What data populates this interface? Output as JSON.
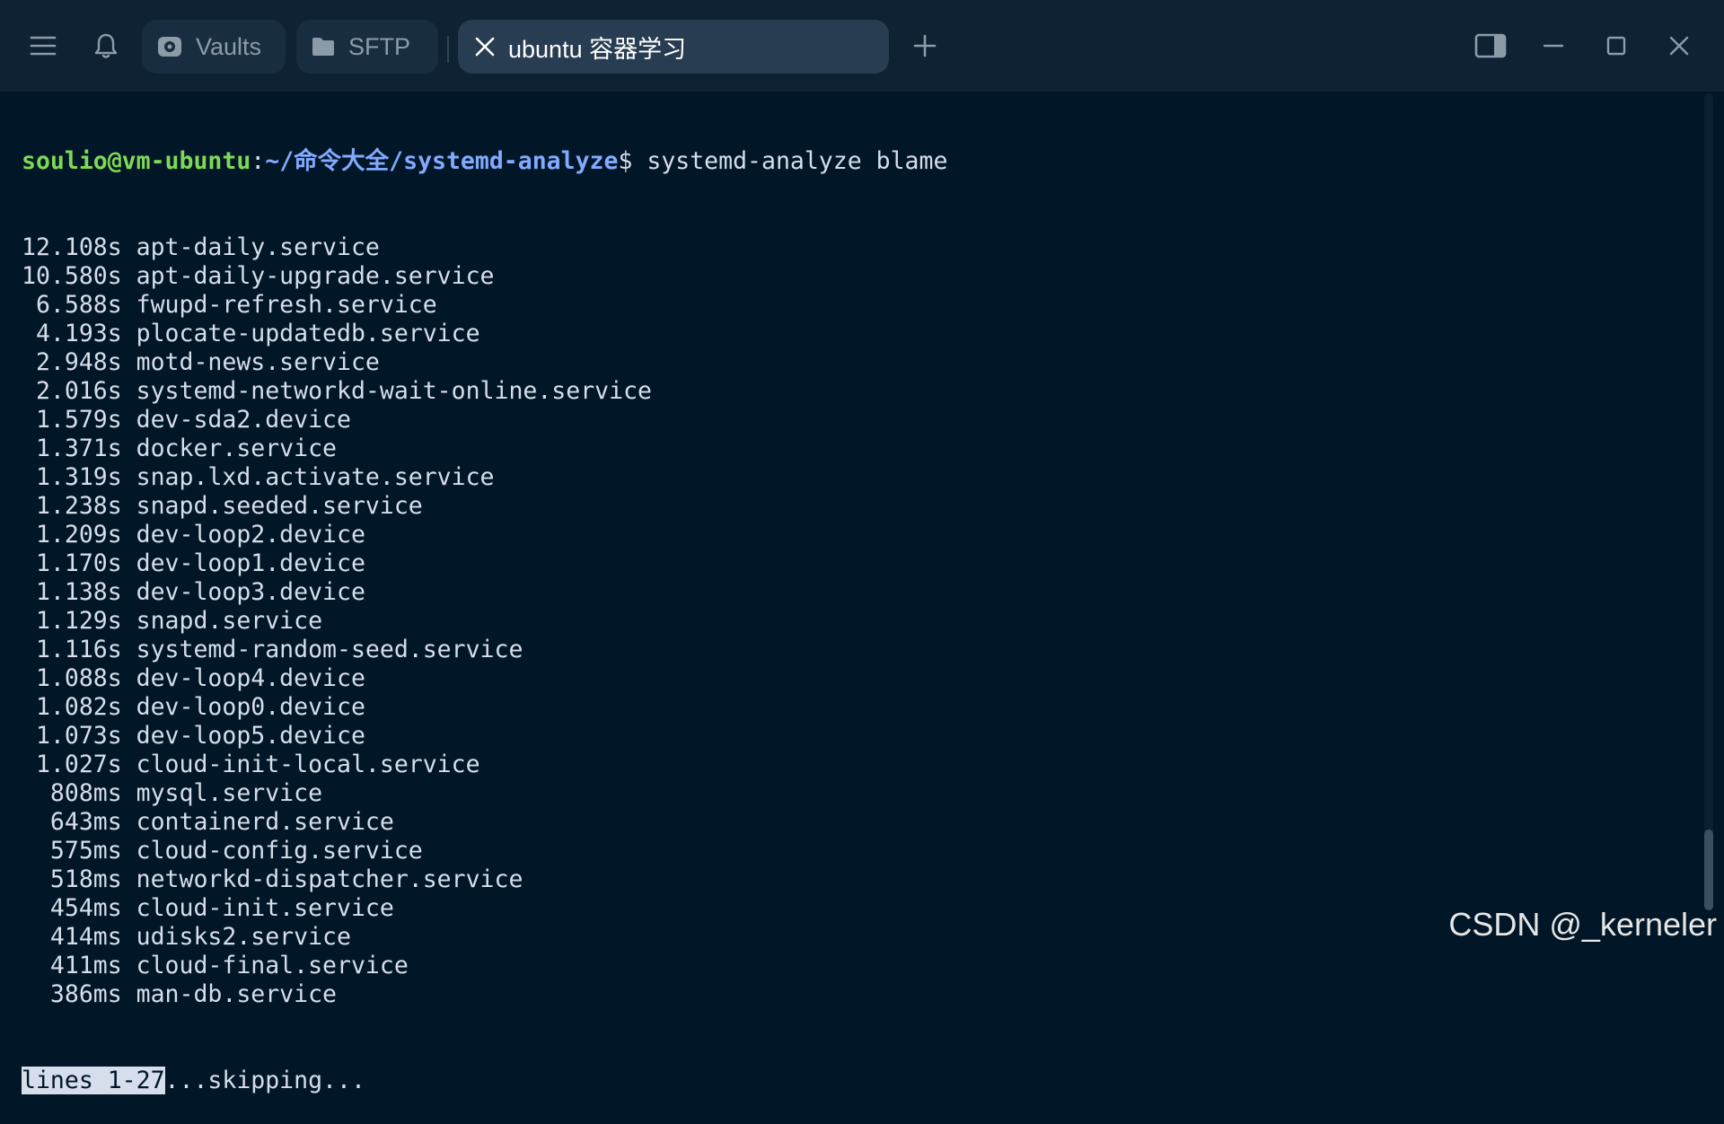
{
  "header": {
    "tabs": [
      {
        "label": "Vaults",
        "icon": "vault-icon"
      },
      {
        "label": "SFTP",
        "icon": "folder-icon"
      },
      {
        "label": "ubuntu 容器学习",
        "icon": "close-icon"
      }
    ]
  },
  "terminal": {
    "prompt_user": "soulio@vm-ubuntu",
    "prompt_sep": ":",
    "prompt_path": "~/命令大全/systemd-analyze",
    "prompt_dollar": "$ ",
    "command": "systemd-analyze blame",
    "lines": [
      "12.108s apt-daily.service",
      "10.580s apt-daily-upgrade.service",
      " 6.588s fwupd-refresh.service",
      " 4.193s plocate-updatedb.service",
      " 2.948s motd-news.service",
      " 2.016s systemd-networkd-wait-online.service",
      " 1.579s dev-sda2.device",
      " 1.371s docker.service",
      " 1.319s snap.lxd.activate.service",
      " 1.238s snapd.seeded.service",
      " 1.209s dev-loop2.device",
      " 1.170s dev-loop1.device",
      " 1.138s dev-loop3.device",
      " 1.129s snapd.service",
      " 1.116s systemd-random-seed.service",
      " 1.088s dev-loop4.device",
      " 1.082s dev-loop0.device",
      " 1.073s dev-loop5.device",
      " 1.027s cloud-init-local.service",
      "  808ms mysql.service",
      "  643ms containerd.service",
      "  575ms cloud-config.service",
      "  518ms networkd-dispatcher.service",
      "  454ms cloud-init.service",
      "  414ms udisks2.service",
      "  411ms cloud-final.service",
      "  386ms man-db.service"
    ],
    "status_highlight": "lines 1-27",
    "status_rest": "...skipping..."
  },
  "watermark": "CSDN @_kerneler",
  "colors": {
    "background": "#011627",
    "prompt_user": "#7ed957",
    "prompt_path": "#82aaff"
  }
}
